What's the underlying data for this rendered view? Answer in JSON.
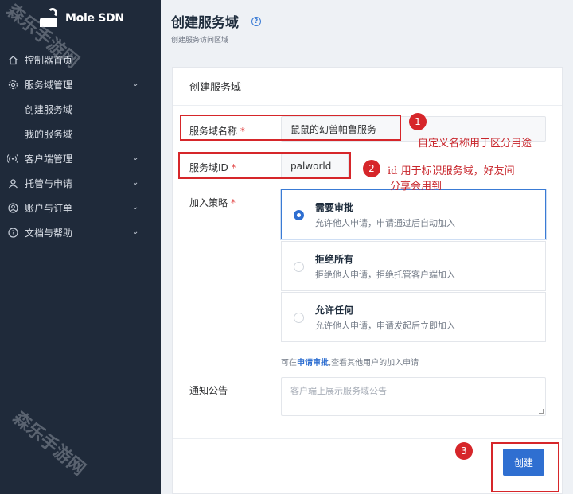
{
  "app": {
    "name": "Mole SDN"
  },
  "sidebar": {
    "items": [
      {
        "label": "控制器首页",
        "icon": "home-icon",
        "chev": ""
      },
      {
        "label": "服务域管理",
        "icon": "gear-icon",
        "chev": "⌄"
      },
      {
        "label": "创建服务域",
        "icon": "",
        "chev": ""
      },
      {
        "label": "我的服务域",
        "icon": "",
        "chev": ""
      },
      {
        "label": "客户端管理",
        "icon": "signal-icon",
        "chev": "⌄"
      },
      {
        "label": "托管与申请",
        "icon": "user-icon",
        "chev": "⌄"
      },
      {
        "label": "账户与订单",
        "icon": "account-icon",
        "chev": "⌄"
      },
      {
        "label": "文档与帮助",
        "icon": "help-icon",
        "chev": "⌄"
      }
    ]
  },
  "header": {
    "title": "创建服务域",
    "subtitle": "创建服务访问区域"
  },
  "form": {
    "card_title": "创建服务域",
    "name_label": "服务域名称",
    "name_value": "鼠鼠的幻兽帕鲁服务",
    "id_label": "服务域ID",
    "id_value": "palworld",
    "policy_label": "加入策略",
    "required_mark": "*",
    "policies": [
      {
        "title": "需要审批",
        "desc": "允许他人申请，申请通过后自动加入",
        "selected": true
      },
      {
        "title": "拒绝所有",
        "desc": "拒绝他人申请，拒绝托管客户端加入",
        "selected": false
      },
      {
        "title": "允许任何",
        "desc": "允许他人申请，申请发起后立即加入",
        "selected": false
      }
    ],
    "hint_prefix": "可在",
    "hint_link": "申请审批",
    "hint_suffix": ",查看其他用户的加入申请",
    "notice_label": "通知公告",
    "notice_placeholder": "客户端上展示服务域公告",
    "create_button": "创建"
  },
  "annotations": {
    "n1": "1",
    "n2": "2",
    "n3": "3",
    "text1": "自定义名称用于区分用途",
    "text2_line1": "id 用于标识服务域，好友间",
    "text2_line2": "分享会用到"
  },
  "watermark": "森乐手游网",
  "colors": {
    "sidebar_bg": "#1f2a3a",
    "primary": "#2f6fd1",
    "annotation": "#d6262a"
  }
}
